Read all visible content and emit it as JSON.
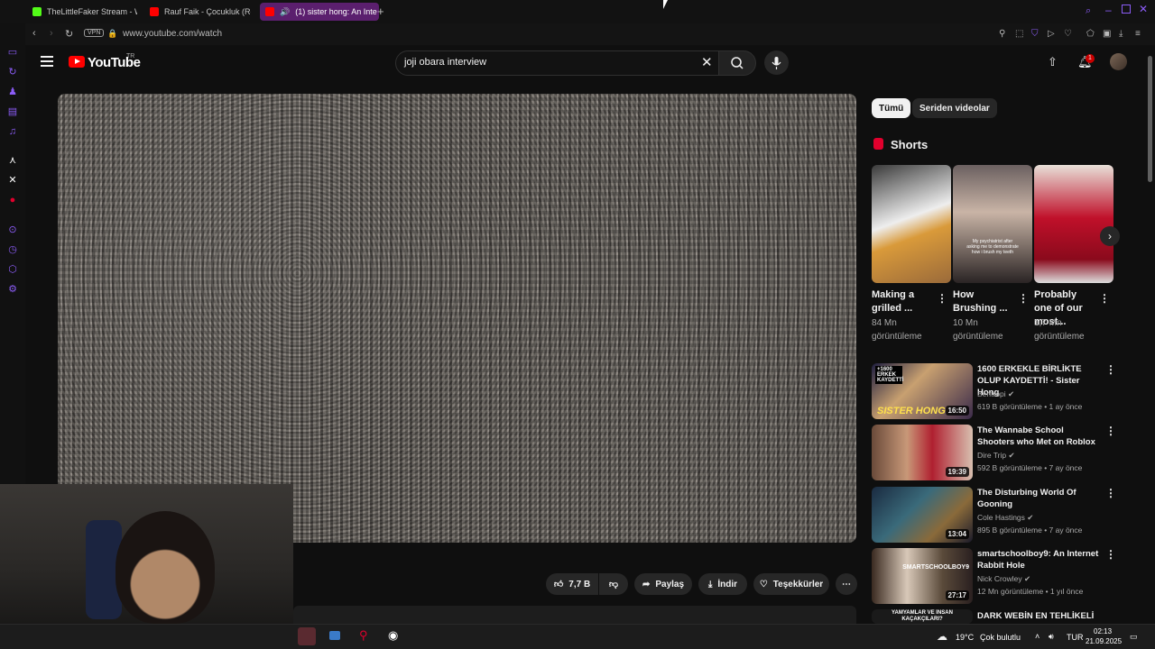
{
  "browser": {
    "tabs": [
      {
        "label": "TheLittleFaker Stream - W",
        "favicon_color": "#53fc18"
      },
      {
        "label": "Rauf Faik - Çocukluk (Re",
        "favicon_color": "#ff0000"
      },
      {
        "label": "(1) sister hong: An Inte",
        "favicon_color": "#ff0000"
      }
    ],
    "vpn_label": "VPN",
    "url": "www.youtube.com/watch",
    "accent": "#8b5cf6"
  },
  "youtube": {
    "logo_text": "YouTube",
    "logo_region": "TR",
    "search_value": "joji obara interview",
    "notification_count": "1",
    "actions": {
      "likes": "7,7 B",
      "share": "Paylaş",
      "download": "İndir",
      "thanks": "Teşekkürler"
    },
    "chips": [
      "Tümü",
      "Seriden videolar"
    ],
    "shorts": {
      "heading": "Shorts",
      "items": [
        {
          "title": "Making a grilled ...",
          "views": "84 Mn görüntüleme"
        },
        {
          "title": "How Brushing ...",
          "views": "10 Mn görüntüleme",
          "overlay": "My psychiatrist after asking me to demonstrate how i brush my teeth"
        },
        {
          "title": "Probably one of our most...",
          "views": "1,7 Mn görüntüleme"
        }
      ]
    },
    "related": [
      {
        "title": "1600 ERKEKLE BİRLİKTE OLUP KAYDETTİ! - Sister Hong",
        "channel": "Bentropi",
        "meta": "619 B görüntüleme • 1 ay önce",
        "duration": "16:50",
        "thumb_text": "SISTER HONG",
        "thumb_tag": "+1600 ERKEK KAYDETTİ"
      },
      {
        "title": "The Wannabe School Shooters who Met on Roblox",
        "channel": "Dire Trip",
        "meta": "592 B görüntüleme • 7 ay önce",
        "duration": "19:39"
      },
      {
        "title": "The Disturbing World Of Gooning",
        "channel": "Cole Hastings",
        "meta": "895 B görüntüleme • 7 ay önce",
        "duration": "13:04"
      },
      {
        "title": "smartschoolboy9: An Internet Rabbit Hole",
        "channel": "Nick Crowley",
        "meta": "12 Mn görüntüleme • 1 yıl önce",
        "duration": "27:17",
        "thumb_text": "SMARTSCHOOLBOY9"
      },
      {
        "title": "DARK WEBİN EN TEHLİKELİ",
        "channel": "",
        "meta": "",
        "duration": "",
        "thumb_text": "YAMYAMLAR VE İNSAN KAÇAKÇILARI?"
      }
    ]
  },
  "taskbar": {
    "weather": "19°C",
    "weather_desc": "Çok bulutlu",
    "lang": "TUR",
    "time": "02:13",
    "date": "21.09.2025"
  }
}
